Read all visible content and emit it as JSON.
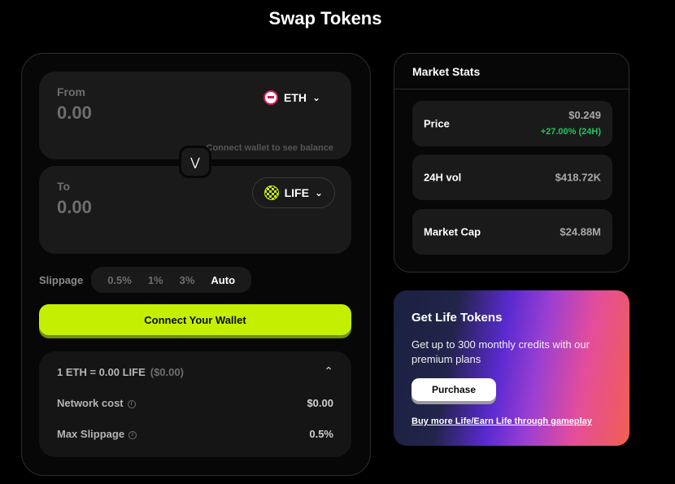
{
  "page": {
    "title": "Swap Tokens"
  },
  "swap": {
    "from": {
      "label": "From",
      "amount": "0.00",
      "token": "ETH",
      "icon": "eth-token-icon",
      "balance_note": "Connect wallet to see balance"
    },
    "to": {
      "label": "To",
      "amount": "0.00",
      "token": "LIFE",
      "icon": "life-token-icon"
    },
    "toggle_icon": "double-chevron-down-icon",
    "slippage": {
      "label": "Slippage",
      "options": [
        "0.5%",
        "1%",
        "3%",
        "Auto"
      ],
      "selected": "Auto"
    },
    "connect_label": "Connect Your Wallet",
    "details": {
      "rate": "1 ETH = 0.00 LIFE",
      "rate_usd": "($0.00)",
      "network_cost_label": "Network cost",
      "network_cost_value": "$0.00",
      "max_slippage_label": "Max Slippage",
      "max_slippage_value": "0.5%"
    }
  },
  "market": {
    "title": "Market Stats",
    "price_label": "Price",
    "price_value": "$0.249",
    "price_change": "+27.00% (24H)",
    "vol_label": "24H vol",
    "vol_value": "$418.72K",
    "cap_label": "Market Cap",
    "cap_value": "$24.88M"
  },
  "promo": {
    "title": "Get Life Tokens",
    "description": "Get up to 300 monthly credits with our premium plans",
    "purchase_label": "Purchase",
    "link_text": "Buy more Life/Earn Life through gameplay"
  },
  "colors": {
    "accent": "#c4f000",
    "positive": "#22c55e",
    "panel": "#1a1a1a"
  }
}
